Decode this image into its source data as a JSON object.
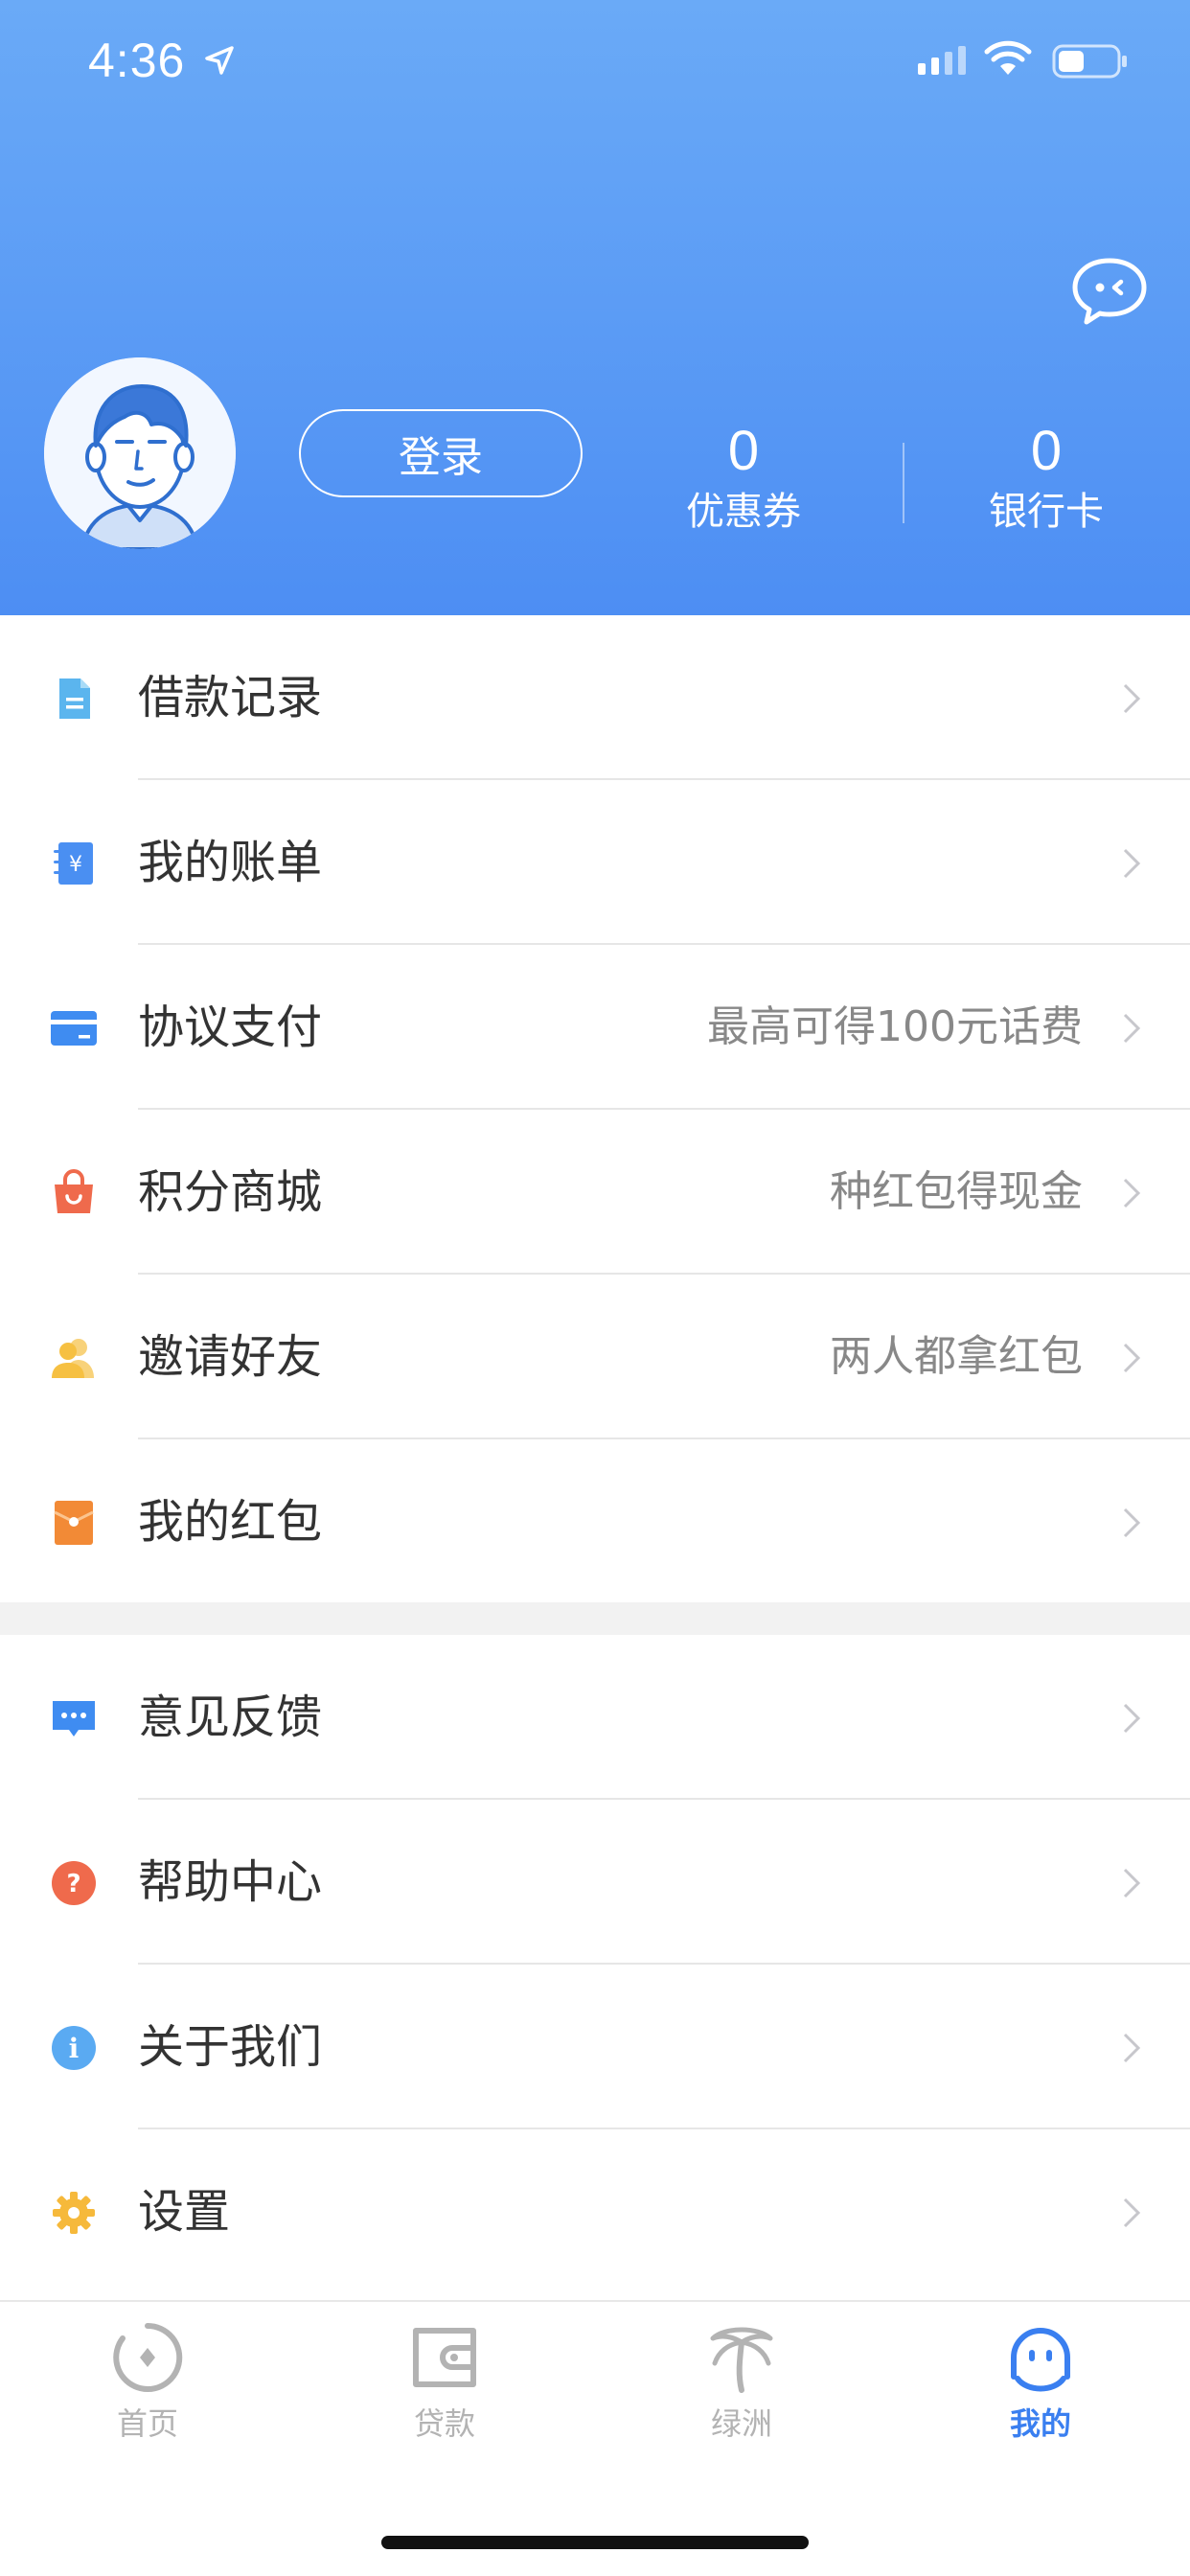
{
  "status_bar": {
    "time": "4:36"
  },
  "profile": {
    "login_label": "登录",
    "coupon_count": "0",
    "coupon_label": "优惠券",
    "bankcard_count": "0",
    "bankcard_label": "银行卡"
  },
  "menu_primary": [
    {
      "label": "借款记录",
      "hint": "",
      "icon": "document-icon",
      "color": "#5bb5ee"
    },
    {
      "label": "我的账单",
      "hint": "",
      "icon": "bill-icon",
      "color": "#4a8ff2"
    },
    {
      "label": "协议支付",
      "hint": "最高可得100元话费",
      "icon": "card-icon",
      "color": "#3f8cf1"
    },
    {
      "label": "积分商城",
      "hint": "种红包得现金",
      "icon": "shopping-bag-icon",
      "color": "#ef6a4c"
    },
    {
      "label": "邀请好友",
      "hint": "两人都拿红包",
      "icon": "friends-icon",
      "color": "#f6c042"
    },
    {
      "label": "我的红包",
      "hint": "",
      "icon": "red-envelope-icon",
      "color": "#f28a36"
    }
  ],
  "menu_secondary": [
    {
      "label": "意见反馈",
      "hint": "",
      "icon": "feedback-icon",
      "color": "#3f8cf1"
    },
    {
      "label": "帮助中心",
      "hint": "",
      "icon": "help-icon",
      "color": "#ef6a4c"
    },
    {
      "label": "关于我们",
      "hint": "",
      "icon": "info-icon",
      "color": "#5aaaf2"
    },
    {
      "label": "设置",
      "hint": "",
      "icon": "settings-icon",
      "color": "#f6b93b"
    }
  ],
  "tabs": [
    {
      "label": "首页",
      "icon": "home-icon",
      "active": false
    },
    {
      "label": "贷款",
      "icon": "wallet-icon",
      "active": false
    },
    {
      "label": "绿洲",
      "icon": "palm-tree-icon",
      "active": false
    },
    {
      "label": "我的",
      "icon": "mine-face-icon",
      "active": true
    }
  ],
  "colors": {
    "accent": "#3a7ff0",
    "header_top": "#6aaaf7",
    "header_bottom": "#4d8ef3"
  }
}
